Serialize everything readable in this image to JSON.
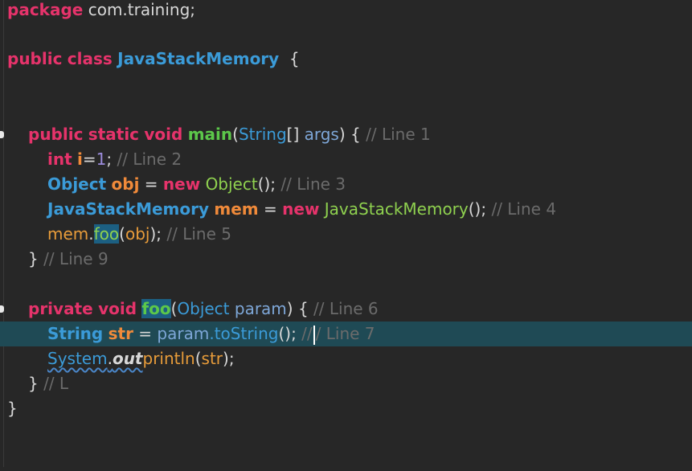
{
  "editor": {
    "lines": {
      "l1": {
        "kw": "package",
        "rest": " com.training;"
      },
      "l2": {
        "kw1": "public",
        "kw2": "class",
        "cls": "JavaStackMemory",
        "rest": "  {"
      },
      "l3": {
        "kw1": "public",
        "kw2": "static",
        "kw3": "void",
        "method": "main",
        "p1": "(",
        "type": "String",
        "p2": "[] ",
        "arg": "args",
        "p3": ") { ",
        "cmt": "// Line 1"
      },
      "l4": {
        "kw": "int",
        "var": "i",
        "eq": "=",
        "num": "1",
        "semi": "; ",
        "cmt": "// Line 2"
      },
      "l5": {
        "type": "Object",
        "var": "obj",
        "eq": " = ",
        "kw": "new",
        "ctor": "Object",
        "rest": "(); ",
        "cmt": "// Line 3"
      },
      "l6": {
        "type": "JavaStackMemory",
        "var": "mem",
        "eq": " = ",
        "kw": "new",
        "ctor": "JavaStackMemory",
        "rest": "(); ",
        "cmt": "// Line 4"
      },
      "l7": {
        "obj": "mem",
        "dot": ".",
        "method": "foo",
        "p1": "(",
        "arg": "obj",
        "rest": "); ",
        "cmt": "// Line 5"
      },
      "l8": {
        "brace": "} ",
        "cmt": "// Line 9"
      },
      "l9": {
        "kw1": "private",
        "kw2": "void",
        "method": "foo",
        "p1": "(",
        "type": "Object",
        "arg": "param",
        "rest": ") { ",
        "cmt": "// Line 6"
      },
      "l10": {
        "type": "String",
        "var": "str",
        "eq": " = ",
        "obj": "param",
        "call": ".toString",
        "rest": "(); ",
        "cmt1": "//",
        "cmt2": "/ Line 7"
      },
      "l11": {
        "cls": "System",
        "dot": ".",
        "field": "out",
        "call": "println",
        "p1": "(",
        "arg": "str",
        "rest": ");"
      },
      "l12": {
        "brace": "} ",
        "cmt": "// L"
      },
      "l13": {
        "brace": "}"
      }
    }
  },
  "colors": {
    "background": "#272727",
    "keyword": "#e6336b",
    "type": "#3b9bd8",
    "method": "#5cc84a",
    "comment": "#6b6b6b",
    "current_line": "#1f4a55",
    "occurrence_highlight": "#1c5f82"
  }
}
